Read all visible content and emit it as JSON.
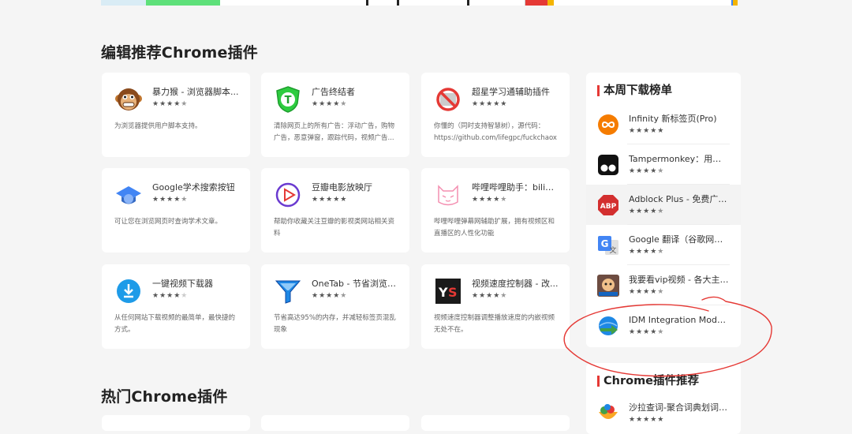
{
  "sections": {
    "editor_picks": "编辑推荐Chrome插件",
    "hot": "热门Chrome插件"
  },
  "colors": {
    "background": "#f5f5f5",
    "card": "#ffffff",
    "accent": "#e53935",
    "annotation": "#e53935"
  },
  "cards": [
    {
      "name": "暴力猴 - 浏览器脚本...",
      "stars": "★★★★★",
      "rating": 4.5,
      "desc": "为浏览器提供用户脚本支持。",
      "icon": "monkey-icon"
    },
    {
      "name": "广告终结者",
      "stars": "★★★★★",
      "rating": 4.5,
      "desc": "清除网页上的所有广告：浮动广告，购物广告，恶意弹窗，跟踪代码，视频广告...",
      "icon": "shield-t-icon"
    },
    {
      "name": "超星学习通辅助插件",
      "stars": "★★★★★",
      "rating": 5,
      "desc": "你懂的（同时支持智慧树），源代码：https://github.com/lifegpc/fuckchaox",
      "icon": "no-sign-icon"
    },
    {
      "name": "Google学术搜索按钮",
      "stars": "★★★★★",
      "rating": 4.5,
      "desc": "可让您在浏览网页时查询学术文章。",
      "icon": "scholar-cap-icon"
    },
    {
      "name": "豆瓣电影放映厅",
      "stars": "★★★★★",
      "rating": 5,
      "desc": "帮助你收藏关注豆瓣的影视类网站相关资料",
      "icon": "play-circle-icon"
    },
    {
      "name": "哔哩哔哩助手：bilibili...",
      "stars": "★★★★★",
      "rating": 4.5,
      "desc": "哔哩哔哩弹幕网辅助扩展，拥有视频区和直播区的人性化功能",
      "icon": "bilibili-cat-icon"
    },
    {
      "name": "一键视频下载器",
      "stars": "★★★★★",
      "rating": 4,
      "desc": "从任何网站下载视频的最简单，最快捷的方式。",
      "icon": "download-circle-icon"
    },
    {
      "name": "OneTab - 节省浏览器...",
      "stars": "★★★★★",
      "rating": 4.5,
      "desc": "节省高达95%的内存，并减轻标签页混乱现象",
      "icon": "funnel-icon"
    },
    {
      "name": "视频速度控制器 - 改...",
      "stars": "★★★★★",
      "rating": 4.5,
      "desc": "视频速度控制器调整播放速度的内嵌视频无处不在。",
      "icon": "ys-logo-icon"
    }
  ],
  "weekly": {
    "title": "本周下载榜单",
    "items": [
      {
        "name": "Infinity 新标签页(Pro)",
        "stars": "★★★★★",
        "rating": 5,
        "icon": "infinity-icon"
      },
      {
        "name": "Tampermonkey：用户脚...",
        "stars": "★★★★★",
        "rating": 4.5,
        "icon": "tampermonkey-icon"
      },
      {
        "name": "Adblock Plus - 免费广告...",
        "stars": "★★★★★",
        "rating": 4.5,
        "icon": "abp-stop-icon"
      },
      {
        "name": "Google 翻译（谷歌网页...",
        "stars": "★★★★★",
        "rating": 4.5,
        "icon": "google-translate-icon"
      },
      {
        "name": "我要看vip视频 - 各大主流...",
        "stars": "★★★★★",
        "rating": 4.5,
        "icon": "vip-video-icon"
      },
      {
        "name": "IDM Integration Module...",
        "stars": "★★★★★",
        "rating": 4.5,
        "icon": "idm-globe-icon"
      }
    ]
  },
  "recommend": {
    "title": "Chrome插件推荐",
    "items": [
      {
        "name": "沙拉查词-聚合词典划词翻译",
        "stars": "★★★★★",
        "rating": 5,
        "icon": "salad-icon"
      }
    ]
  }
}
